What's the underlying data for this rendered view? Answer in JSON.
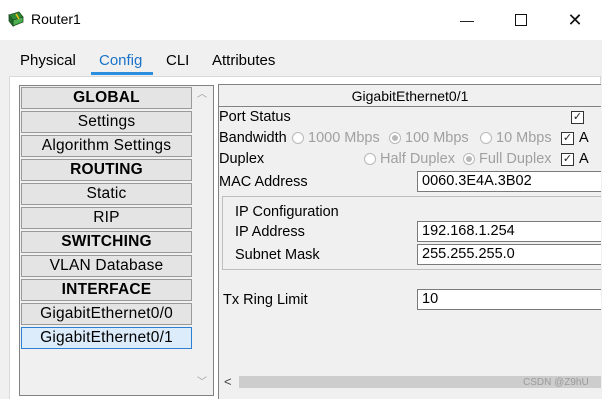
{
  "window": {
    "title": "Router1",
    "minimize_glyph": "—",
    "close_glyph": "✕",
    "icon": "router-icon"
  },
  "tabs": [
    {
      "label": "Physical",
      "active": false
    },
    {
      "label": "Config",
      "active": true
    },
    {
      "label": "CLI",
      "active": false
    },
    {
      "label": "Attributes",
      "active": false
    }
  ],
  "sidebar": {
    "items": [
      {
        "label": "GLOBAL",
        "header": true
      },
      {
        "label": "Settings",
        "header": false
      },
      {
        "label": "Algorithm Settings",
        "header": false
      },
      {
        "label": "ROUTING",
        "header": true
      },
      {
        "label": "Static",
        "header": false
      },
      {
        "label": "RIP",
        "header": false
      },
      {
        "label": "SWITCHING",
        "header": true
      },
      {
        "label": "VLAN Database",
        "header": false
      },
      {
        "label": "INTERFACE",
        "header": true
      },
      {
        "label": "GigabitEthernet0/0",
        "header": false
      },
      {
        "label": "GigabitEthernet0/1",
        "header": false,
        "selected": true
      }
    ],
    "scroll_up_glyph": "︿",
    "scroll_down_glyph": "﹀"
  },
  "panel": {
    "title": "GigabitEthernet0/1",
    "port_status_label": "Port Status",
    "port_status_checked": true,
    "bandwidth_label": "Bandwidth",
    "bandwidth_options": [
      "1000 Mbps",
      "100 Mbps",
      "10 Mbps"
    ],
    "bandwidth_selected": "100 Mbps",
    "bandwidth_auto_label": "A",
    "duplex_label": "Duplex",
    "duplex_options": [
      "Half Duplex",
      "Full Duplex"
    ],
    "duplex_selected": "Full Duplex",
    "duplex_auto_label": "A",
    "check_glyph": "✓",
    "mac_label": "MAC Address",
    "mac_value": "0060.3E4A.3B02",
    "ip_config_label": "IP Configuration",
    "ip_label": "IP Address",
    "ip_value": "192.168.1.254",
    "mask_label": "Subnet Mask",
    "mask_value": "255.255.255.0",
    "tx_label": "Tx Ring Limit",
    "tx_value": "10",
    "hscroll_left_glyph": "<"
  },
  "watermark": "CSDN @Z9hU",
  "colors": {
    "accent": "#2b8fe0",
    "selected_bg": "#dcecfb",
    "selected_border": "#2d7fd3"
  }
}
